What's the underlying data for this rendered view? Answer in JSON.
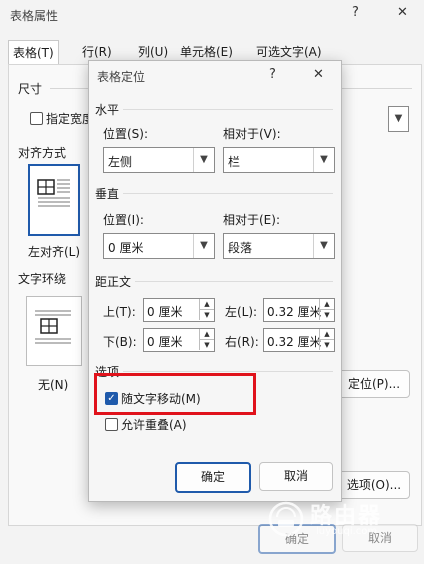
{
  "back_dialog": {
    "title": "表格属性",
    "tabs": [
      {
        "label": "表格(T)"
      },
      {
        "label": "行(R)"
      },
      {
        "label": "列(U)"
      },
      {
        "label": "单元格(E)"
      },
      {
        "label": "可选文字(A)"
      }
    ],
    "size_label": "尺寸",
    "preferred_width": "指定宽度",
    "alignment_label": "对齐方式",
    "align_left": "左对齐(L)",
    "wrapping_label": "文字环绕",
    "wrap_none": "无(N)",
    "position_button": "定位(P)...",
    "options_button": "选项(O)...",
    "ok": "确定",
    "cancel": "取消"
  },
  "dialog": {
    "title": "表格定位",
    "horizontal": {
      "group": "水平",
      "position_label": "位置(S):",
      "position_value": "左侧",
      "relative_label": "相对于(V):",
      "relative_value": "栏"
    },
    "vertical": {
      "group": "垂直",
      "position_label": "位置(I):",
      "position_value": "0 厘米",
      "relative_label": "相对于(E):",
      "relative_value": "段落"
    },
    "distance": {
      "group": "距正文",
      "top_label": "上(T):",
      "top_value": "0 厘米",
      "left_label": "左(L):",
      "left_value": "0.32 厘米",
      "bottom_label": "下(B):",
      "bottom_value": "0 厘米",
      "right_label": "右(R):",
      "right_value": "0.32 厘米"
    },
    "options": {
      "group": "选项",
      "move_with_text": "随文字移动(M)",
      "move_with_text_checked": true,
      "allow_overlap": "允许重叠(A)",
      "allow_overlap_checked": false
    },
    "ok": "确定",
    "cancel": "取消"
  },
  "watermark": {
    "text": "路由器",
    "sub": "luyouqi.com"
  },
  "colors": {
    "accent": "#1f5aab",
    "highlight": "#e0121b"
  }
}
